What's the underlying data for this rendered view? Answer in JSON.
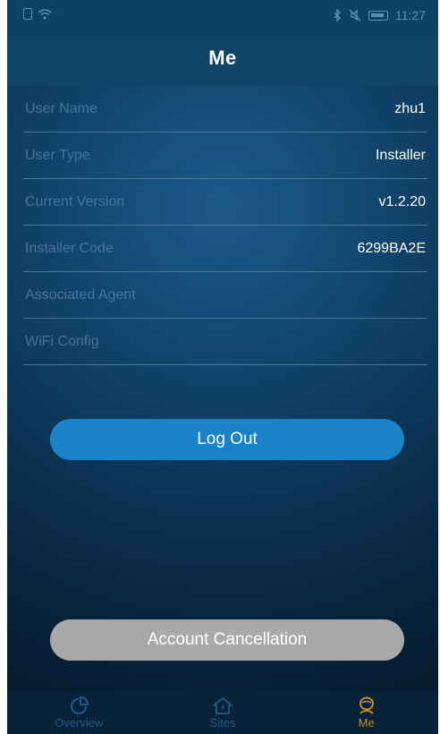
{
  "status_bar": {
    "time": "11:27"
  },
  "header": {
    "title": "Me"
  },
  "info_rows": [
    {
      "label": "User Name",
      "value": "zhu1"
    },
    {
      "label": "User Type",
      "value": "Installer"
    },
    {
      "label": "Current Version",
      "value": "v1.2.20"
    },
    {
      "label": "Installer Code",
      "value": "6299BA2E"
    },
    {
      "label": "Associated Agent",
      "value": ""
    },
    {
      "label": "WiFi Config",
      "value": ""
    }
  ],
  "buttons": {
    "logout": "Log Out",
    "account_cancellation": "Account Cancellation"
  },
  "tabs": [
    {
      "label": "Overview",
      "icon": "pie-chart-icon",
      "active": false
    },
    {
      "label": "Sites",
      "icon": "home-bolt-icon",
      "active": false
    },
    {
      "label": "Me",
      "icon": "user-icon",
      "active": true
    }
  ],
  "colors": {
    "accent": "#1a82c8",
    "active_tab": "#c98a1b",
    "inactive_tab": "#1f5c8c",
    "cancel_button": "#a9a9a9"
  }
}
